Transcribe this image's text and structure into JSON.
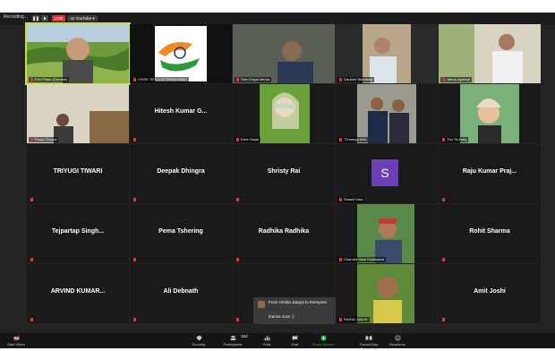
{
  "topbar": {
    "recording": "Recording...",
    "live": "LIVE",
    "on_youtube": "on YouTube"
  },
  "tiles": {
    "r1": [
      "Ech Pham (Gemwe)",
      "VIVEK TIFLO-UTTARAKHAND",
      "Ram Dayal verma",
      "Gautam Bhardwaj",
      "Jaeus Agarwal"
    ],
    "r2": [
      "Pooja Chopra",
      "Hitesh Kumar G...",
      "Elvie Gayle",
      "T.Kompgi inen",
      "Thu Ta Aung"
    ],
    "r3": [
      "TRIYUGI TIWARI",
      "Deepak Dhingra",
      "Shristy Rai",
      "Shashi Kala",
      "Raju Kumar Praj..."
    ],
    "r4": [
      "Tejpartap Singh...",
      "Pema Tshering",
      "Radhika Radhika",
      "Chandra Mani Khatiwada",
      "Rohit Sharma"
    ],
    "r5": [
      "ARVIND KUMAR...",
      "Ali Debnath",
      "",
      "RAHUL MALIK",
      "Amit Joshi"
    ]
  },
  "s_avatar": "S",
  "chat": {
    "from": "From Urmila Jangra to Everyone",
    "message": "thanks mam :)"
  },
  "toolbar": {
    "start_video": "Start Video",
    "security": "Security",
    "participants": "Participants",
    "participant_count": "342",
    "polls": "Polls",
    "chat": "Chat",
    "share_screen": "Share Screen",
    "pause_recording": "Pause/Stop Recording",
    "reactions": "Reactions"
  },
  "colors": {
    "accent_green": "#2fb34a",
    "active_border": "#c8e142",
    "live_red": "#e03333",
    "avatar_purple": "#6b3fb5"
  }
}
